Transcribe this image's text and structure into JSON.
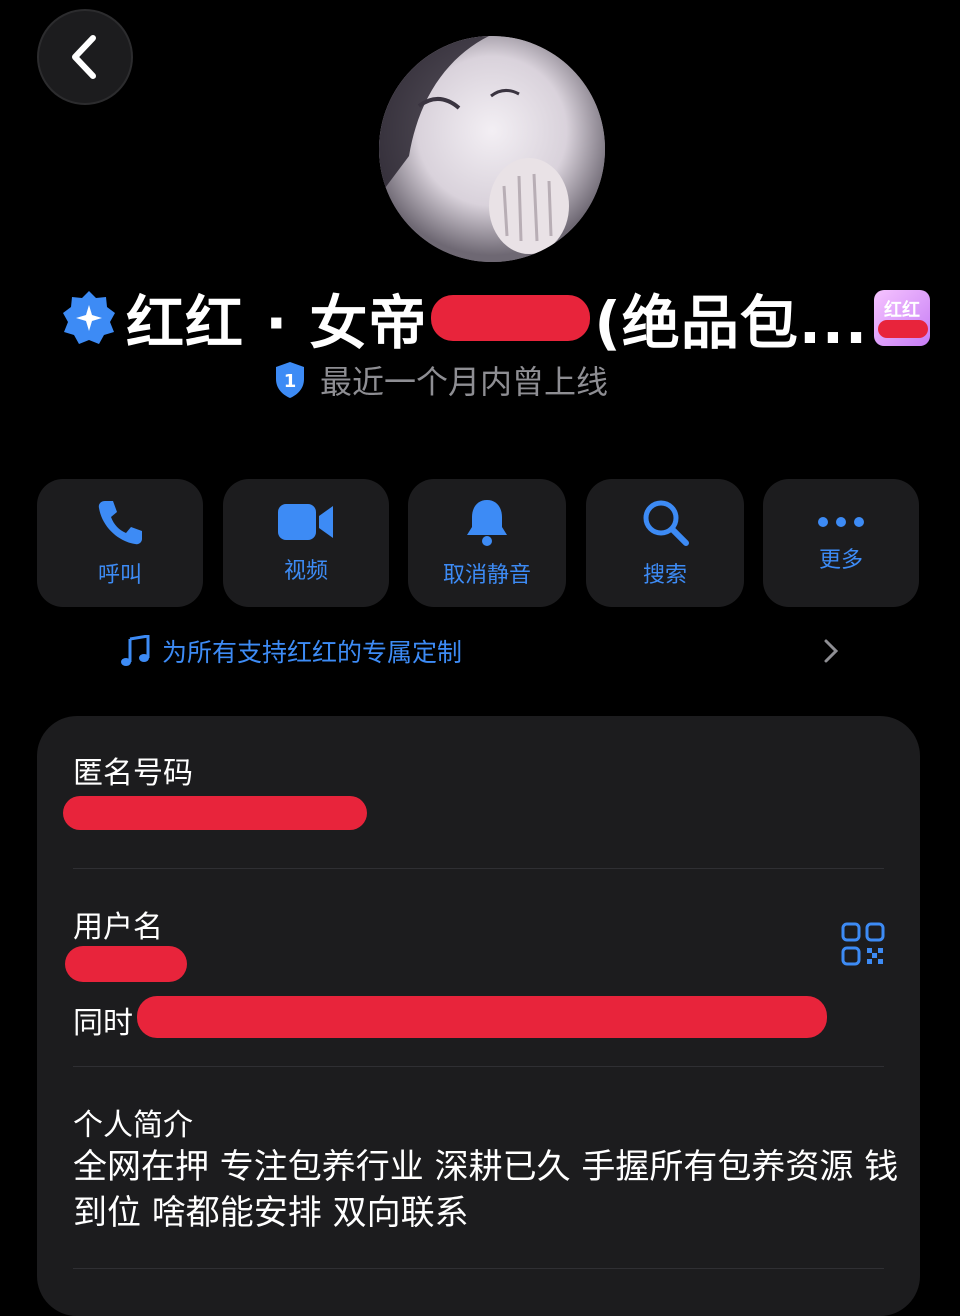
{
  "header": {
    "back_icon": "chevron-left-icon",
    "display_name_prefix": "红红 · 女帝",
    "display_name_suffix": "(绝品包...",
    "name_tag": "红红",
    "status_badge_number": "1",
    "status_text": "最近一个月内曾上线"
  },
  "actions": [
    {
      "label": "呼叫",
      "icon": "phone-icon"
    },
    {
      "label": "视频",
      "icon": "video-camera-icon"
    },
    {
      "label": "取消静音",
      "icon": "bell-icon"
    },
    {
      "label": "搜索",
      "icon": "search-icon"
    },
    {
      "label": "更多",
      "icon": "more-dots-icon"
    }
  ],
  "custom": {
    "text": "为所有支持红红的专属定制",
    "icon": "music-note-icon"
  },
  "info": {
    "anonymous_number_label": "匿名号码",
    "username_label": "用户名",
    "same_time_prefix": "同时",
    "bio_label": "个人简介",
    "bio_text": "全网在押 专注包养行业 深耕已久 手握所有包养资源 钱到位 啥都能安排 双向联系"
  },
  "colors": {
    "accent": "#3d8bf5",
    "redaction": "#e8243b",
    "card_bg": "#1c1c1e",
    "muted_text": "#8e8e93"
  }
}
